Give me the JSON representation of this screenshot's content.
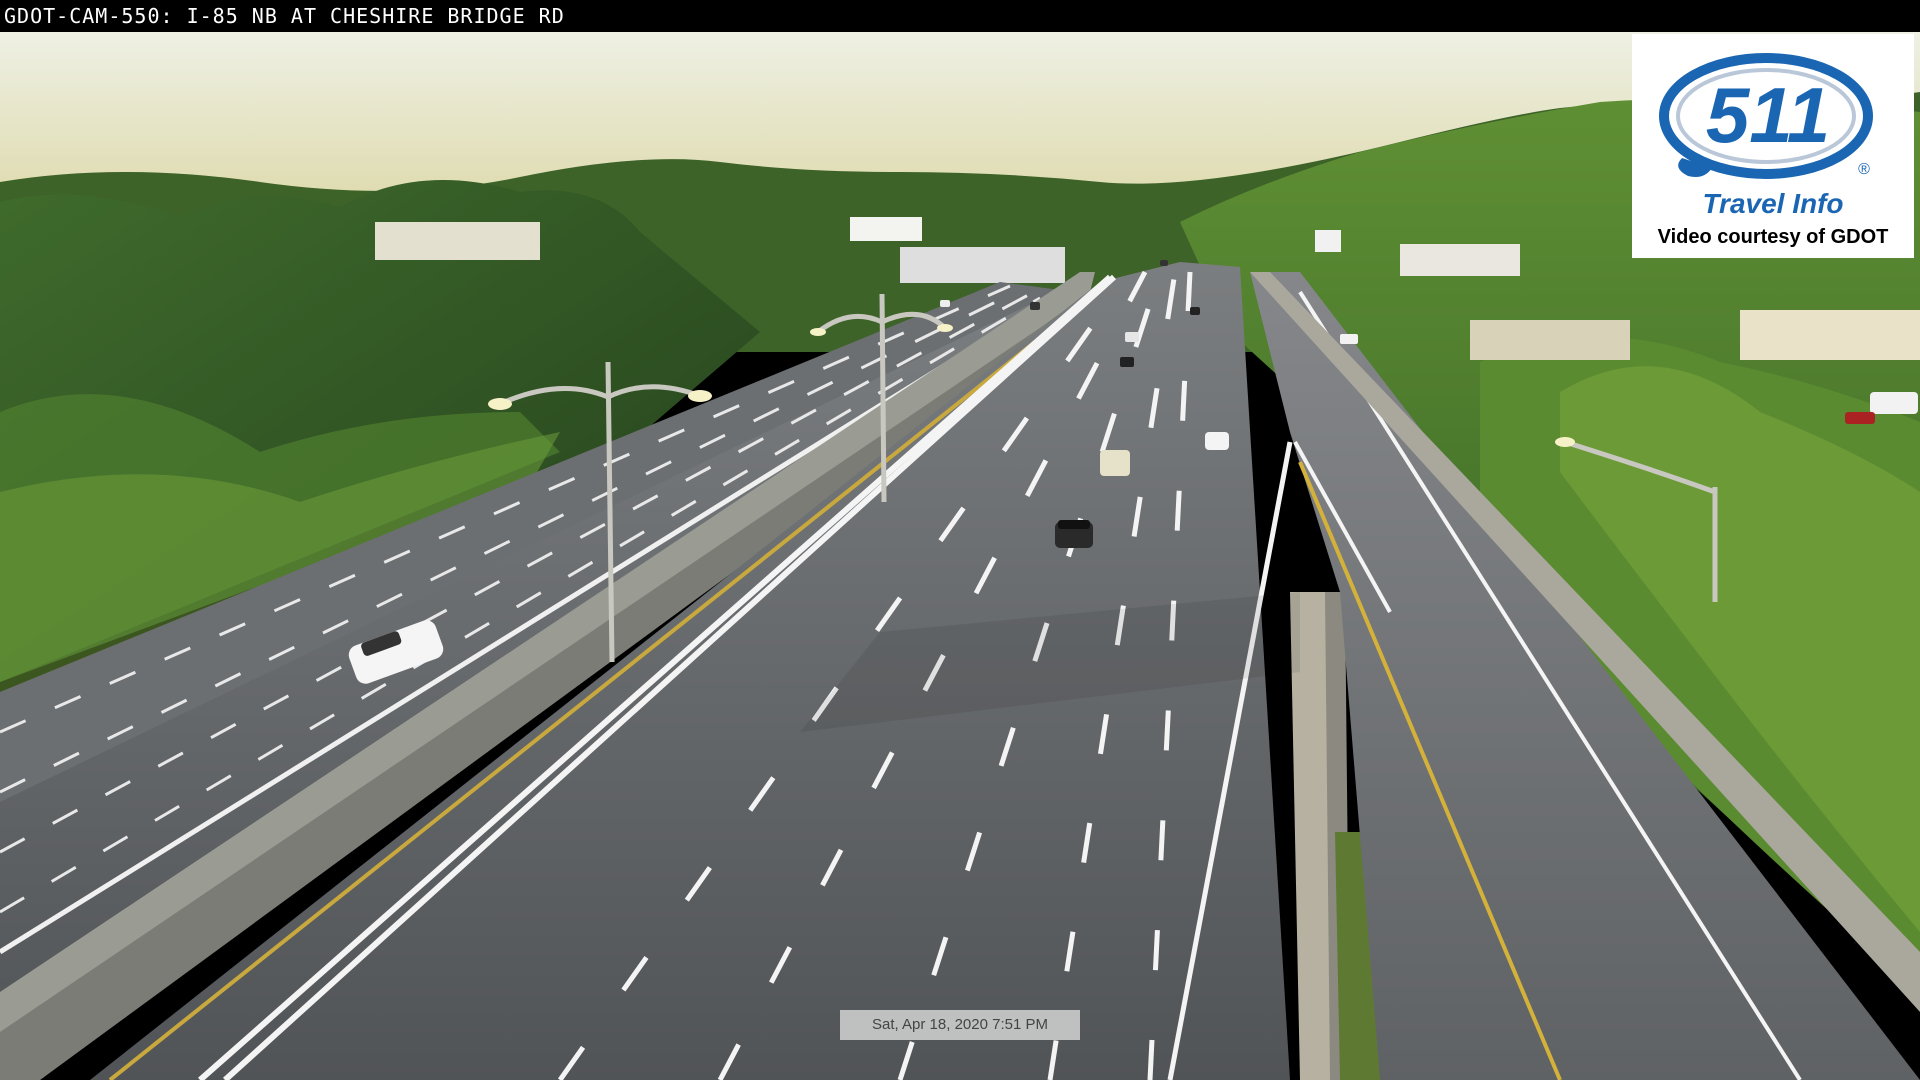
{
  "camera": {
    "title": "GDOT-CAM-550: I-85 NB AT CHESHIRE BRIDGE RD",
    "timestamp": "Sat, Apr 18, 2020  7:51 PM"
  },
  "logo": {
    "number": "511",
    "registered": "®",
    "tagline": "Travel Info",
    "courtesy": "Video courtesy of GDOT"
  },
  "colors": {
    "sky_top": "#e8e7d8",
    "sky_horizon": "#d9d6a6",
    "trees_dark": "#2c4a22",
    "trees_light": "#6f9a3c",
    "asphalt": "#5a5d61",
    "wall": "#8f918a",
    "logo_blue": "#1b66b3"
  }
}
